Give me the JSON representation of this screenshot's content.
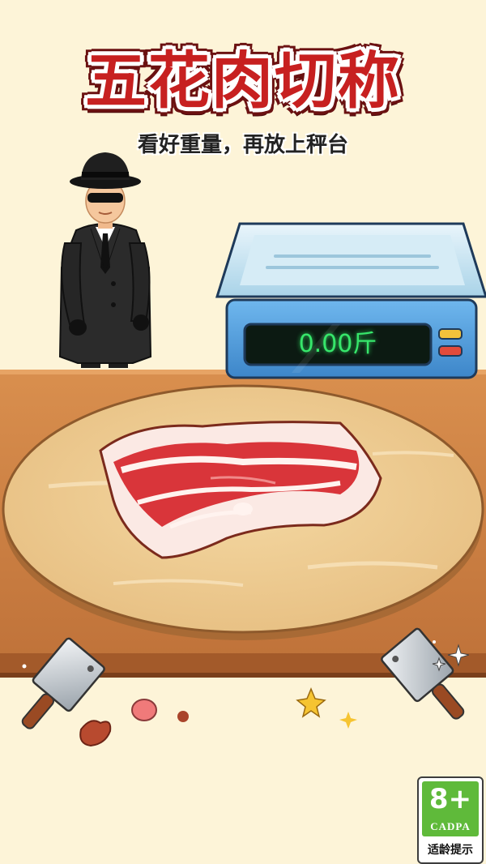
{
  "title": "五花肉切称",
  "subtitle": "看好重量，再放上秤台",
  "scale": {
    "readout": "0.00斤"
  },
  "rating": {
    "age": "8+",
    "org": "CADPA",
    "tip": "适龄提示"
  },
  "colors": {
    "background": "#fdf4d8",
    "title": "#c72020",
    "readout": "#37e66b",
    "counter": "#c8793f",
    "rating_green": "#5fba3a"
  }
}
